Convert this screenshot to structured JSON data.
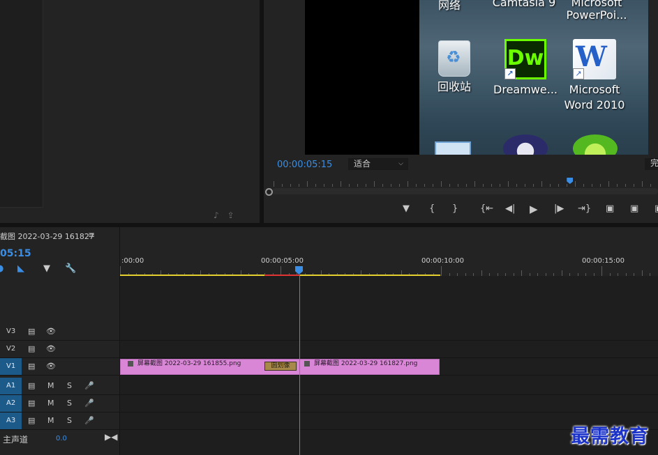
{
  "project_panel": {
    "footer_icons": [
      "♪",
      "⇪"
    ]
  },
  "program_monitor": {
    "desktop_icons": {
      "top_labels": [
        "网络",
        "Camtasia 9",
        "Microsoft",
        "PowerPoi..."
      ],
      "recycle_bin": "回收站",
      "dreamweaver": "Dreamwe...",
      "dreamweaver_glyph": "Dw",
      "word_line1": "Microsoft",
      "word_line2": "Word 2010",
      "word_glyph": "W"
    },
    "timecode": "00:00:05:15",
    "fit_select": "适合",
    "quality_select": "完",
    "progress_fraction": 0.77
  },
  "timeline": {
    "tab_title": "截图 2022-03-29 161827",
    "menu_icon": "≡",
    "timecode": "05:15",
    "ruler_labels": [
      ":00:00",
      "00:00:05:00",
      "00:00:10:00",
      "00:00:15:00"
    ],
    "tracks": {
      "v3": "V3",
      "v2": "V2",
      "v1": "V1",
      "a1": "A1",
      "a2": "A2",
      "a3": "A3"
    },
    "mute": "M",
    "solo": "S",
    "clips": {
      "clip1": "屏幕截图 2022-03-29 161855.png",
      "clip2": "屏幕截图 2022-03-29 161827.png",
      "transition": "圆划像"
    },
    "master": {
      "label": "主声道",
      "value": "0.0"
    }
  },
  "watermark": "最需教育"
}
